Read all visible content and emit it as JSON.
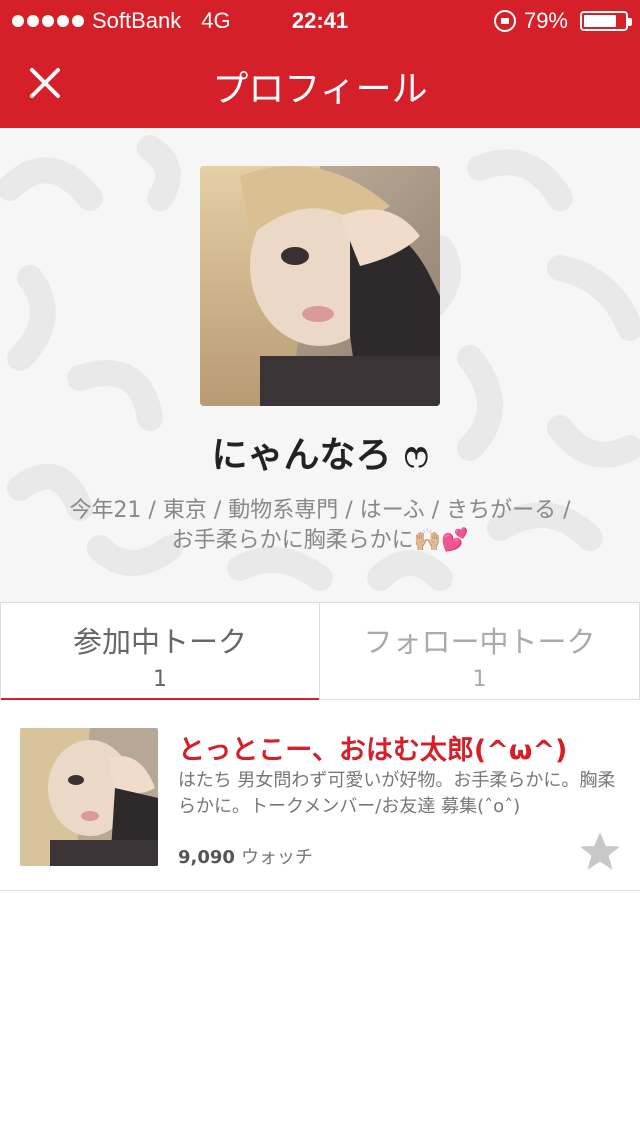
{
  "status_bar": {
    "carrier": "SoftBank",
    "network": "4G",
    "time": "22:41",
    "battery_percent": "79%",
    "battery_level": 0.79,
    "signal_dots": 5
  },
  "nav": {
    "title": "プロフィール",
    "close_icon": "close-icon"
  },
  "profile": {
    "name": "にゃんなろ ෆ",
    "bio_line1": "今年21 / 東京 / 動物系専門 / はーふ / きちがーる /",
    "bio_line2": "お手柔らかに胸柔らかに🙌🏼💕"
  },
  "tabs": [
    {
      "label": "参加中トーク",
      "count": "1",
      "active": true
    },
    {
      "label": "フォロー中トーク",
      "count": "1",
      "active": false
    }
  ],
  "talk": {
    "title": "とっとこー、おはむ太郎(^ω^)",
    "description": "はたち 男女問わず可愛いが好物。お手柔らかに。胸柔らかに。トークメンバー/お友達 募集(ˆoˆ)",
    "watch_count": "9,090",
    "watch_label": "ウォッチ",
    "star_icon": "star-icon"
  },
  "colors": {
    "brand_red": "#d52029",
    "star_gray": "#c8c8c8"
  }
}
